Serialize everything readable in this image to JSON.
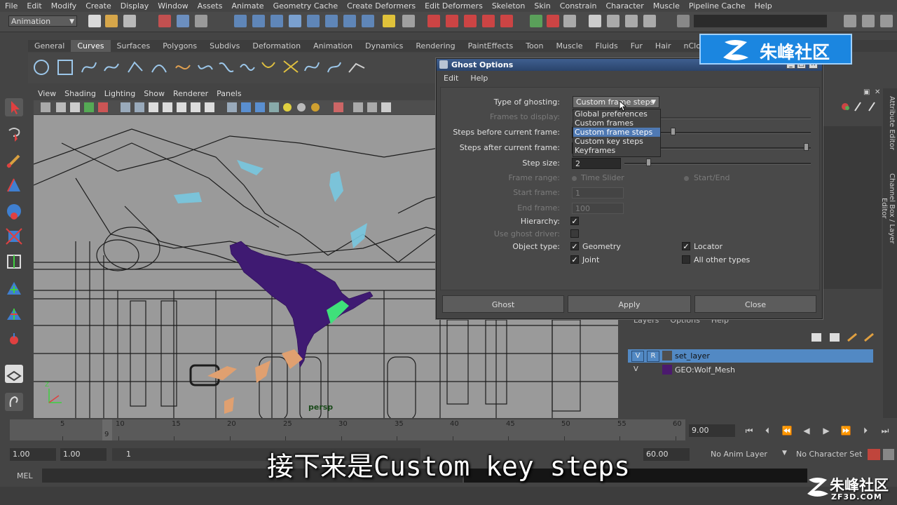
{
  "menubar": [
    "File",
    "Edit",
    "Modify",
    "Create",
    "Display",
    "Window",
    "Assets",
    "Animate",
    "Geometry Cache",
    "Create Deformers",
    "Edit Deformers",
    "Skeleton",
    "Skin",
    "Constrain",
    "Character",
    "Muscle",
    "Pipeline Cache",
    "Help"
  ],
  "statusline": {
    "mode": "Animation"
  },
  "shelf": {
    "tabs": [
      "General",
      "Curves",
      "Surfaces",
      "Polygons",
      "Subdivs",
      "Deformation",
      "Animation",
      "Dynamics",
      "Rendering",
      "PaintEffects",
      "Toon",
      "Muscle",
      "Fluids",
      "Fur",
      "Hair",
      "nClo"
    ],
    "active_tab": "Curves"
  },
  "viewport": {
    "menu": [
      "View",
      "Shading",
      "Lighting",
      "Show",
      "Renderer",
      "Panels"
    ],
    "camera_label": "persp",
    "axis_z": "Z"
  },
  "layers": {
    "menu": [
      "Layers",
      "Options",
      "Help"
    ],
    "rows": [
      {
        "v": "V",
        "r": "R",
        "name": "set_layer",
        "color": "#4f4f4f"
      },
      {
        "v": "V",
        "r": "",
        "name": "GEO:Wolf_Mesh",
        "color": "#4b1a6e"
      }
    ]
  },
  "side_tabs": [
    "Attribute Editor",
    "Channel Box / Layer Editor"
  ],
  "timeline": {
    "ticks": [
      "5",
      "10",
      "15",
      "20",
      "25",
      "30",
      "35",
      "40",
      "45",
      "50",
      "55",
      "60"
    ],
    "current_marker": "9",
    "current_frame": "9.00"
  },
  "range": {
    "start": "1.00",
    "anim_start": "1.00",
    "slider_start": "1",
    "anim_end": "60.00",
    "anim_layer": "No Anim Layer",
    "character_set": "No Character Set"
  },
  "mel": {
    "label": "MEL"
  },
  "subtitle": "接下来是Custom key steps",
  "watermark": {
    "top": "朱峰社区",
    "bottom": "朱峰社区",
    "bottom_url": "ZF3D.COM"
  },
  "dialog": {
    "title": "Ghost Options",
    "menu": [
      "Edit",
      "Help"
    ],
    "type_of_ghosting": {
      "label": "Type of ghosting:",
      "value": "Custom frame steps",
      "options": [
        "Global preferences",
        "Custom frames",
        "Custom frame steps",
        "Custom key steps",
        "Keyframes"
      ],
      "selected": "Custom frame steps"
    },
    "frames_to_display_label": "Frames to display:",
    "steps_before_label": "Steps before current frame:",
    "steps_after_label": "Steps after current frame:",
    "step_size": {
      "label": "Step size:",
      "value": "2"
    },
    "frame_range": {
      "label": "Frame range:",
      "opt1": "Time Slider",
      "opt2": "Start/End"
    },
    "start_frame": {
      "label": "Start frame:",
      "value": "1"
    },
    "end_frame": {
      "label": "End frame:",
      "value": "100"
    },
    "hierarchy_label": "Hierarchy:",
    "use_ghost_driver_label": "Use ghost driver:",
    "object_type": {
      "label": "Object type:",
      "geometry": "Geometry",
      "locator": "Locator",
      "joint": "Joint",
      "all_other": "All other types"
    },
    "buttons": {
      "ghost": "Ghost",
      "apply": "Apply",
      "close": "Close"
    }
  }
}
